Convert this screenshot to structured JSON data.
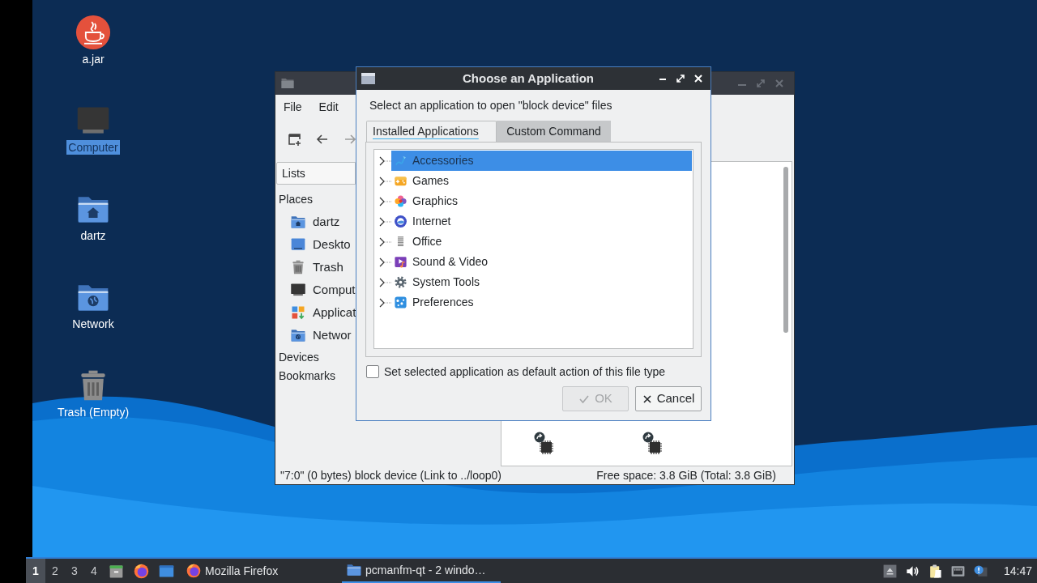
{
  "desktop_icons": [
    {
      "label": "a.jar",
      "kind": "jar",
      "selected": false
    },
    {
      "label": "Computer",
      "kind": "computer",
      "selected": true
    },
    {
      "label": "dartz",
      "kind": "home",
      "selected": false
    },
    {
      "label": "Network",
      "kind": "network",
      "selected": false
    },
    {
      "label": "Trash (Empty)",
      "kind": "trash",
      "selected": false
    }
  ],
  "file_manager": {
    "menu": [
      "File",
      "Edit"
    ],
    "view_selector": "Lists",
    "sidebar": [
      {
        "title": "Places",
        "items": [
          {
            "label": "dartz",
            "kind": "home"
          },
          {
            "label": "Deskto",
            "kind": "desktop"
          },
          {
            "label": "Trash",
            "kind": "trash"
          },
          {
            "label": "Comput",
            "kind": "computer"
          },
          {
            "label": "Applicat",
            "kind": "applications"
          },
          {
            "label": "Networ",
            "kind": "network"
          }
        ]
      },
      {
        "title": "Devices"
      },
      {
        "title": "Bookmarks"
      }
    ],
    "files": [
      {
        "kind": "block-device-link"
      },
      {
        "kind": "block-device-link"
      }
    ],
    "status_bar": {
      "selection": "\"7:0\" (0 bytes) block device (Link to ../loop0)",
      "free_space": "Free space: 3.8 GiB (Total: 3.8 GiB)"
    }
  },
  "dialog": {
    "title": "Choose an Application",
    "prompt": "Select an application to open \"block device\" files",
    "tabs": [
      {
        "label": "Installed Applications",
        "selected": true
      },
      {
        "label": "Custom Command",
        "selected": false
      }
    ],
    "tree": [
      {
        "label": "Accessories",
        "kind": "accessories",
        "selected": true
      },
      {
        "label": "Games",
        "kind": "games",
        "selected": false
      },
      {
        "label": "Graphics",
        "kind": "graphics",
        "selected": false
      },
      {
        "label": "Internet",
        "kind": "internet",
        "selected": false
      },
      {
        "label": "Office",
        "kind": "office",
        "selected": false
      },
      {
        "label": "Sound & Video",
        "kind": "sound-video",
        "selected": false
      },
      {
        "label": "System Tools",
        "kind": "system-tools",
        "selected": false
      },
      {
        "label": "Preferences",
        "kind": "preferences",
        "selected": false
      }
    ],
    "default_checkbox": {
      "label": "Set selected application as default action of this file type",
      "checked": false
    },
    "buttons": [
      {
        "label": "OK",
        "kind": "ok",
        "disabled": true
      },
      {
        "label": "Cancel",
        "kind": "cancel",
        "disabled": false
      }
    ]
  },
  "taskbar": {
    "desktops": [
      {
        "label": "1",
        "selected": true
      },
      {
        "label": "2",
        "selected": false
      },
      {
        "label": "3",
        "selected": false
      },
      {
        "label": "4",
        "selected": false
      }
    ],
    "launchers": [
      {
        "kind": "file-cabinet"
      },
      {
        "kind": "firefox"
      },
      {
        "kind": "show-desktop"
      }
    ],
    "tasks": [
      {
        "label": "Mozilla Firefox",
        "kind": "firefox",
        "selected": false
      },
      {
        "label": "pcmanfm-qt - 2 windo…",
        "kind": "folder",
        "selected": true
      }
    ],
    "tray": [
      {
        "kind": "eject"
      },
      {
        "kind": "volume"
      },
      {
        "kind": "clipboard"
      },
      {
        "kind": "network"
      },
      {
        "kind": "notification"
      }
    ],
    "clock": "14:47"
  }
}
